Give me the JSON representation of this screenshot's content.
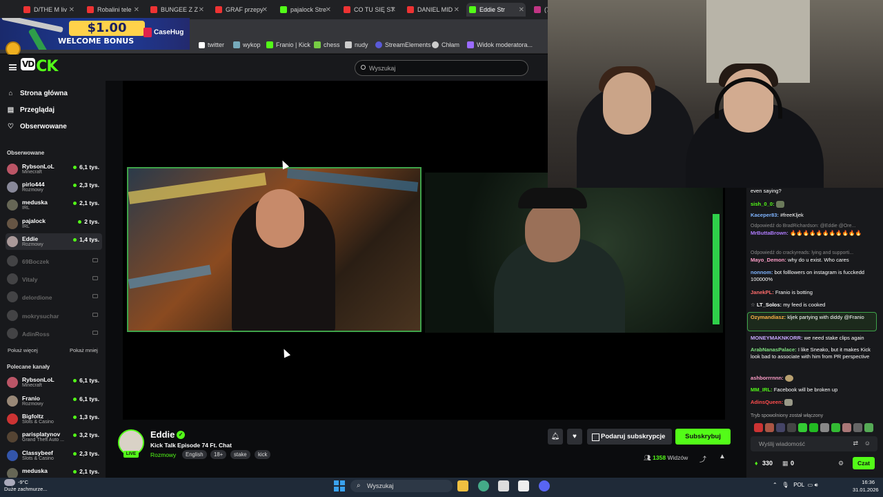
{
  "browser": {
    "tabs": [
      {
        "label": "D/THE M liv",
        "color": "#e33"
      },
      {
        "label": "Robalini tele",
        "color": "#e33"
      },
      {
        "label": "BUNGEE Z Z",
        "color": "#e33"
      },
      {
        "label": "GRAF przepy",
        "color": "#e33"
      },
      {
        "label": "pajalock Stre",
        "color": "#53fc18"
      },
      {
        "label": "CO TU SIĘ ST",
        "color": "#e33"
      },
      {
        "label": "DANIEL MID",
        "color": "#e33"
      },
      {
        "label": "Eddie Str",
        "color": "#53fc18"
      },
      {
        "label": "(7",
        "color": "#c13584"
      }
    ],
    "bookmarks": [
      "twitter",
      "wykop",
      "Franio | Kick",
      "chess",
      "nudy",
      "StreamElements",
      "Chłam",
      "Widok moderatora..."
    ]
  },
  "ad": {
    "amount": "$1.00",
    "text": "WELCOME BONUS",
    "brand": "CaseHug"
  },
  "header": {
    "search_placeholder": "Wyszukaj"
  },
  "sidebar": {
    "nav": [
      {
        "label": "Strona główna",
        "icon": "home-icon"
      },
      {
        "label": "Przeglądaj",
        "icon": "browse-icon"
      },
      {
        "label": "Obserwowane",
        "icon": "heart-icon"
      }
    ],
    "followed_title": "Obserwowane",
    "followed": [
      {
        "name": "RybsonLoL",
        "category": "Minecraft",
        "viewers": "6,1 tys.",
        "live": true
      },
      {
        "name": "pirlo444",
        "category": "Rozmowy",
        "viewers": "2,3 tys.",
        "live": true
      },
      {
        "name": "meduska",
        "category": "IRL",
        "viewers": "2,1 tys.",
        "live": true
      },
      {
        "name": "pajalock",
        "category": "IRL",
        "viewers": "2 tys.",
        "live": true
      },
      {
        "name": "Eddie",
        "category": "Rozmowy",
        "viewers": "1,4 tys.",
        "live": true
      },
      {
        "name": "69Boczek",
        "live": false
      },
      {
        "name": "Vitaly",
        "live": false
      },
      {
        "name": "delordione",
        "live": false
      },
      {
        "name": "mokrysuchar",
        "live": false
      },
      {
        "name": "AdinRoss",
        "live": false
      }
    ],
    "show_more": "Pokaż więcej",
    "show_less": "Pokaż mniej",
    "recommended_title": "Polecane kanały",
    "recommended": [
      {
        "name": "RybsonLoL",
        "category": "Minecraft",
        "viewers": "6,1 tys."
      },
      {
        "name": "Franio",
        "category": "Rozmowy",
        "viewers": "6,1 tys."
      },
      {
        "name": "Bigfoltz",
        "category": "Slots & Casino",
        "viewers": "1,3 tys."
      },
      {
        "name": "parisplatynov",
        "category": "Grand Theft Auto ...",
        "viewers": "3,2 tys."
      },
      {
        "name": "Classybeef",
        "category": "Slots & Casino",
        "viewers": "2,3 tys."
      },
      {
        "name": "meduska",
        "category": "",
        "viewers": "2,1 tys."
      }
    ]
  },
  "stream": {
    "name": "Eddie",
    "live": "LIVE",
    "title": "Kick Talk Episode 74 Ft. Chat",
    "category": "Rozmowy",
    "tags": [
      "English",
      "18+",
      "stake",
      "kick"
    ],
    "gift_label": "Podaruj subskrypcje",
    "subscribe_label": "Subskrybuj",
    "viewers": "1358",
    "viewers_label": "Widzów"
  },
  "chat": {
    "messages": [
      {
        "user": "",
        "color": "#fff",
        "text": "even saying?"
      },
      {
        "user": "sish_0_0:",
        "color": "#53fc18",
        "text": ""
      },
      {
        "user": "Kaceper83:",
        "color": "#7fb4ff",
        "text": "#freeKljek"
      },
      {
        "reply": "Odpowiedź do BradRichardson: @Eddie @Ore...",
        "user": "MrButtaBrown:",
        "color": "#b07cff",
        "text": ""
      },
      {
        "reply": "Odpowiedź do crackyreads: lying and supporti...",
        "user": "Mayo_Demon:",
        "color": "#ff9ec8",
        "text": "why do u exist. Who cares"
      },
      {
        "user": "nonnom:",
        "color": "#7fb4ff",
        "text": "bot folllowers on instagram is fucckedd 100000%"
      },
      {
        "user": "JanekPL:",
        "color": "#ff6b6b",
        "text": "Franio is botting"
      },
      {
        "user": "LT_Solos:",
        "color": "#fff",
        "text": "my feed is cooked"
      },
      {
        "user": "Ozymandiasz:",
        "color": "#ffb347",
        "text": "kljek partying with diddy @Franio"
      },
      {
        "user": "MONEYMAKNKORR:",
        "color": "#c8a8ff",
        "text": "we need stake clips again"
      },
      {
        "user": "ArabNanasPalace:",
        "color": "#7fe07f",
        "text": "I like Sneako, but it makes Kick look bad to associate with him from PR perspective"
      },
      {
        "user": "ashborrrnnn:",
        "color": "#ff9ec8",
        "text": ""
      },
      {
        "user": "MM_IRL:",
        "color": "#53fc18",
        "text": "Facebook will be broken up"
      },
      {
        "user": "AdinsQueen:",
        "color": "#ff4d4d",
        "text": ""
      }
    ],
    "slow_mode": "Tryb spowolniony został włączony",
    "input_placeholder": "Wyślij wiadomość",
    "points": "330",
    "gifts": "0",
    "send_label": "Czat"
  },
  "taskbar": {
    "weather_temp": "-9°C",
    "weather_desc": "Duże zachmurze...",
    "search_placeholder": "Wyszukaj",
    "lang": "POL",
    "time": "16:36",
    "date": "31.01.2026"
  }
}
